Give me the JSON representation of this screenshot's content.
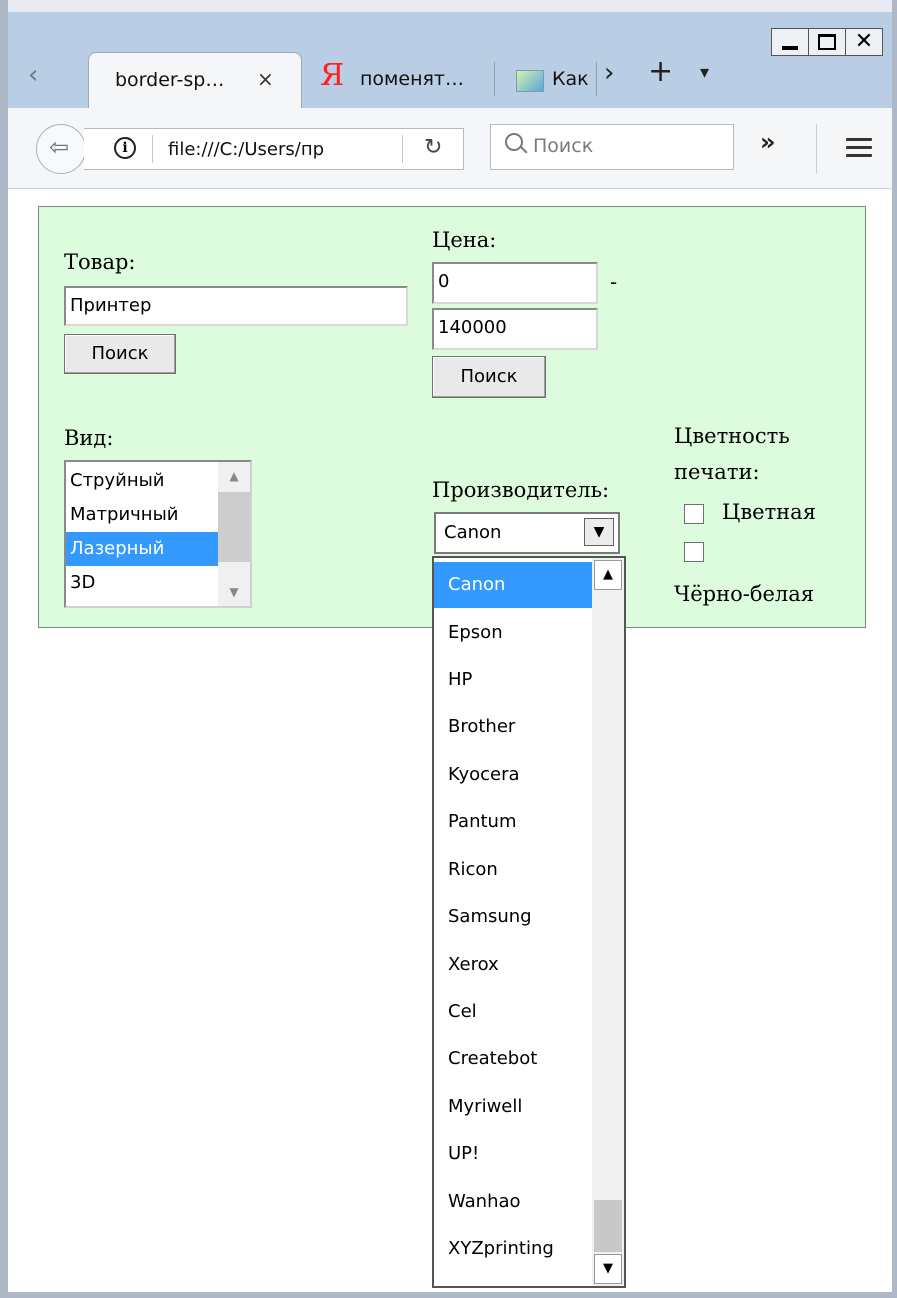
{
  "browser": {
    "tabs": [
      {
        "label": "border-sp…",
        "active": true
      },
      {
        "label": "поменят…",
        "active": false
      },
      {
        "label": "Как",
        "active": false
      }
    ],
    "tab_close_glyph": "×",
    "yandex_logo_letter": "Я",
    "url": "file:///C:/Users/пр",
    "search_placeholder": "Поиск"
  },
  "form": {
    "product_label": "Товар:",
    "product_value": "Принтер",
    "product_search_button": "Поиск",
    "price_label": "Цена:",
    "price_min": "0",
    "price_dash": "-",
    "price_max": "140000",
    "price_search_button": "Поиск",
    "type_label": "Вид:",
    "type_options": [
      "Струйный",
      "Матричный",
      "Лазерный",
      "3D"
    ],
    "type_selected": "Лазерный",
    "manufacturer_label": "Производитель:",
    "manufacturer_value": "Canon",
    "manufacturer_options": [
      "Canon",
      "Epson",
      "HP",
      "Brother",
      "Kyocera",
      "Pantum",
      "Ricon",
      "Samsung",
      "Xerox",
      "Cel",
      "Createbot",
      "Myriwell",
      "UP!",
      "Wanhao",
      "XYZprinting"
    ],
    "color_label_line1": "Цветность",
    "color_label_line2": "печати:",
    "color_option": "Цветная",
    "bw_option": "Чёрно-белая"
  },
  "colors": {
    "panel_bg": "#ddfcdd",
    "selection": "#3399ff",
    "tabbar": "#b9cde4"
  }
}
